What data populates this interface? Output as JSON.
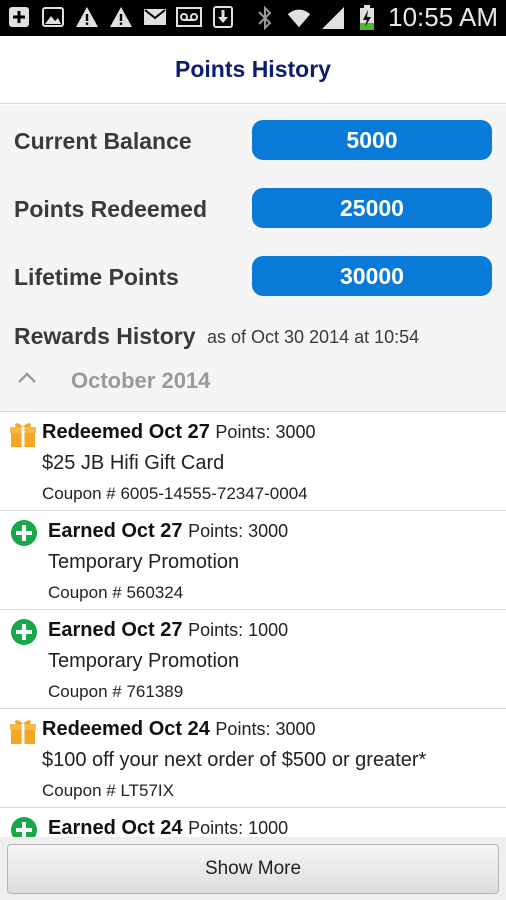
{
  "status_bar": {
    "time": "10:55 AM",
    "icons_left": [
      "plus-icon",
      "image-icon",
      "warning-icon",
      "warning-icon",
      "mail-icon",
      "voicemail-icon",
      "download-icon"
    ],
    "icons_right": [
      "bluetooth-icon",
      "wifi-icon",
      "signal-icon",
      "battery-charging-icon"
    ]
  },
  "header": {
    "title": "Points History"
  },
  "summary": {
    "current_balance_label": "Current Balance",
    "current_balance_value": "5000",
    "points_redeemed_label": "Points Redeemed",
    "points_redeemed_value": "25000",
    "lifetime_points_label": "Lifetime Points",
    "lifetime_points_value": "30000"
  },
  "rewards_history": {
    "title": "Rewards History",
    "as_of": "as of Oct 30 2014 at 10:54",
    "month": "October 2014"
  },
  "items": [
    {
      "type": "redeemed",
      "icon": "gift-icon",
      "title": "Redeemed Oct 27",
      "points": "Points: 3000",
      "description": "$25 JB Hifi Gift Card",
      "coupon": "Coupon # 6005-14555-72347-0004"
    },
    {
      "type": "earned",
      "icon": "plus-circle-icon",
      "title": "Earned Oct 27",
      "points": "Points: 3000",
      "description": "Temporary Promotion",
      "coupon": "Coupon # 560324"
    },
    {
      "type": "earned",
      "icon": "plus-circle-icon",
      "title": "Earned Oct 27",
      "points": "Points: 1000",
      "description": "Temporary Promotion",
      "coupon": "Coupon # 761389"
    },
    {
      "type": "redeemed",
      "icon": "gift-icon",
      "title": "Redeemed Oct 24",
      "points": "Points: 3000",
      "description": "$100 off your next order of $500 or greater*",
      "coupon": "Coupon # LT57IX"
    },
    {
      "type": "earned",
      "icon": "plus-circle-icon",
      "title": "Earned Oct 24",
      "points": "Points: 1000",
      "description": "",
      "coupon": ""
    }
  ],
  "show_more_label": "Show More",
  "colors": {
    "accent_pill": "#0a7ad8",
    "header_title": "#0e1e6e",
    "earned_green": "#18a84a",
    "gift_orange": "#f5a623"
  }
}
